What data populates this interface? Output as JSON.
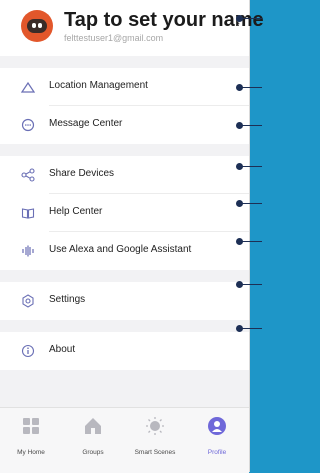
{
  "profile": {
    "name": "Tap to set your name",
    "email": "felttestuser1@gmail.com"
  },
  "menu": {
    "location": "Location Management",
    "message": "Message Center",
    "share": "Share Devices",
    "help": "Help Center",
    "alexa": "Use Alexa and Google Assistant",
    "settings": "Settings",
    "about": "About"
  },
  "tabs": [
    {
      "label": "My Home",
      "icon": "grid-icon"
    },
    {
      "label": "Groups",
      "icon": "house-icon"
    },
    {
      "label": "Smart Scenes",
      "icon": "sun-icon"
    },
    {
      "label": "Profile",
      "icon": "person-icon"
    }
  ],
  "colors": {
    "accent": "#6f68d9",
    "background": "#1e96c8",
    "callout": "#1d2f55",
    "avatar": "#e2572b"
  }
}
